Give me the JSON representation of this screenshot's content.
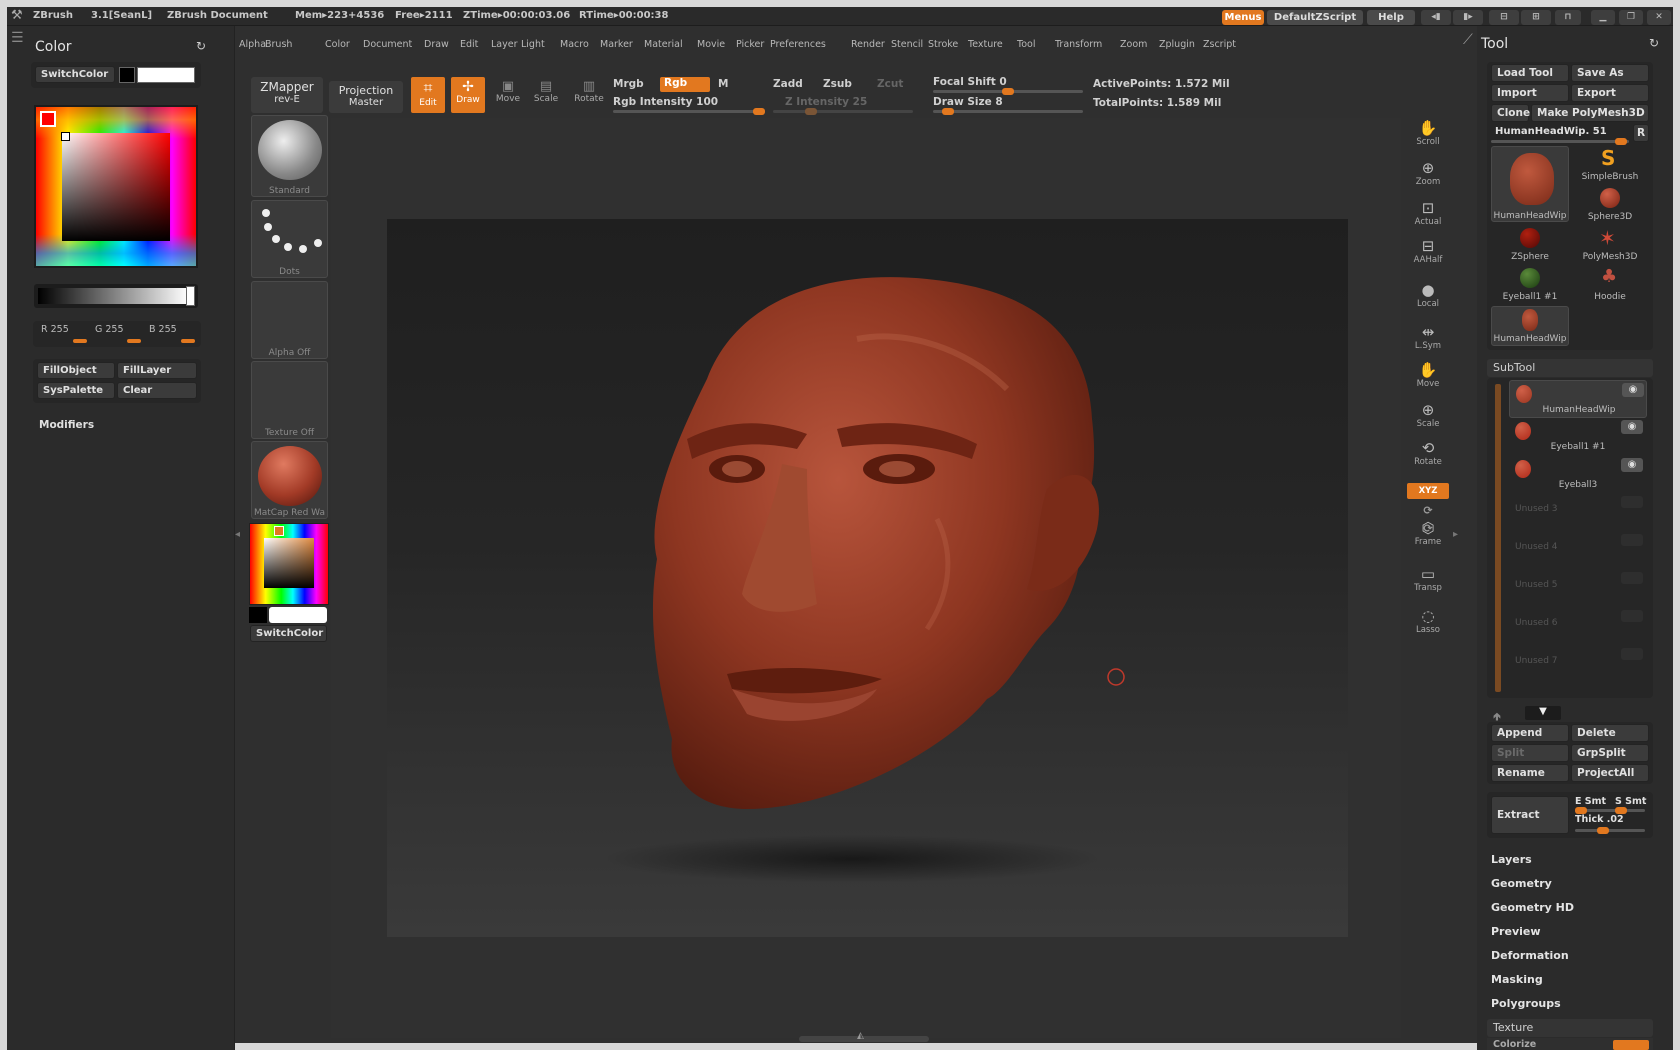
{
  "titlebar": {
    "app": "ZBrush",
    "version": "3.1[SeanL]",
    "document": "ZBrush Document",
    "mem": "Mem▸223+4536",
    "free": "Free▸2111",
    "ztime": "ZTime▸00:00:03.06",
    "rtime": "RTime▸00:00:38",
    "menus_btn": "Menus",
    "script_btn": "DefaultZScript",
    "help_btn": "Help"
  },
  "menubar": [
    "Alpha",
    "Brush",
    "Color",
    "Document",
    "Draw",
    "Edit",
    "Layer",
    "Light",
    "Macro",
    "Marker",
    "Material",
    "Movie",
    "Picker",
    "Preferences",
    "Render",
    "Stencil",
    "Stroke",
    "Texture",
    "Tool",
    "Transform",
    "Zoom",
    "Zplugin",
    "Zscript"
  ],
  "color_panel": {
    "title": "Color",
    "switch_color": "SwitchColor",
    "r": "R 255",
    "g": "G 255",
    "b": "B 255",
    "fill_object": "FillObject",
    "fill_layer": "FillLayer",
    "sys_palette": "SysPalette",
    "clear": "Clear",
    "modifiers": "Modifiers",
    "swatch_main": "#ffffff",
    "swatch_secondary": "#000000"
  },
  "shelf": {
    "brush_label": "Standard",
    "stroke_label": "Dots",
    "alpha_label": "Alpha Off",
    "texture_label": "Texture Off",
    "material_label": "MatCap Red Wa",
    "switch_color": "SwitchColor"
  },
  "toolbar": {
    "zmapper": "ZMapper",
    "zmapper_sub": "rev-E",
    "projection": "Projection",
    "projection_sub": "Master",
    "edit": "Edit",
    "draw": "Draw",
    "move": "Move",
    "scale": "Scale",
    "rotate": "Rotate",
    "mrgb": "Mrgb",
    "rgb": "Rgb",
    "m": "M",
    "rgb_intensity": "Rgb Intensity 100",
    "zadd": "Zadd",
    "zsub": "Zsub",
    "zcut": "Zcut",
    "z_intensity": "Z Intensity 25",
    "focal_shift": "Focal Shift 0",
    "draw_size": "Draw Size 8",
    "active_points": "ActivePoints: 1.572 Mil",
    "total_points": "TotalPoints: 1.589 Mil",
    "rgb_intensity_value": 100,
    "z_intensity_value": 25,
    "focal_shift_value": 0,
    "draw_size_value": 8
  },
  "dock": [
    "Scroll",
    "Zoom",
    "Actual",
    "AAHalf",
    "Local",
    "L.Sym",
    "Move",
    "Scale",
    "Rotate",
    "XYZ",
    "Frame",
    "Transp",
    "Lasso"
  ],
  "tool_panel": {
    "title": "Tool",
    "load_tool": "Load Tool",
    "save_as": "Save As",
    "import": "Import",
    "export": "Export",
    "clone": "Clone",
    "make_polymesh": "Make PolyMesh3D",
    "current_tool": "HumanHeadWip. 51",
    "r_btn": "R",
    "tools": [
      "HumanHeadWip",
      "SimpleBrush",
      "Sphere3D",
      "ZSphere",
      "PolyMesh3D",
      "Eyeball1 #1",
      "Hoodie",
      "HumanHeadWip"
    ],
    "subtool_title": "SubTool",
    "subtools": [
      "HumanHeadWip",
      "Eyeball1 #1",
      "Eyeball3"
    ],
    "unused": [
      "Unused 3",
      "Unused 4",
      "Unused 5",
      "Unused 6",
      "Unused 7"
    ],
    "append": "Append",
    "delete": "Delete",
    "split": "Split",
    "grpsplit": "GrpSplit",
    "rename": "Rename",
    "projectall": "ProjectAll",
    "extract": "Extract",
    "e_smt": "E Smt",
    "s_smt": "S Smt",
    "thick": "Thick .02",
    "sections": [
      "Layers",
      "Geometry",
      "Geometry HD",
      "Preview",
      "Deformation",
      "Masking",
      "Polygroups"
    ],
    "texture": "Texture",
    "colorize": "Colorize"
  },
  "accent": "#e2781f"
}
